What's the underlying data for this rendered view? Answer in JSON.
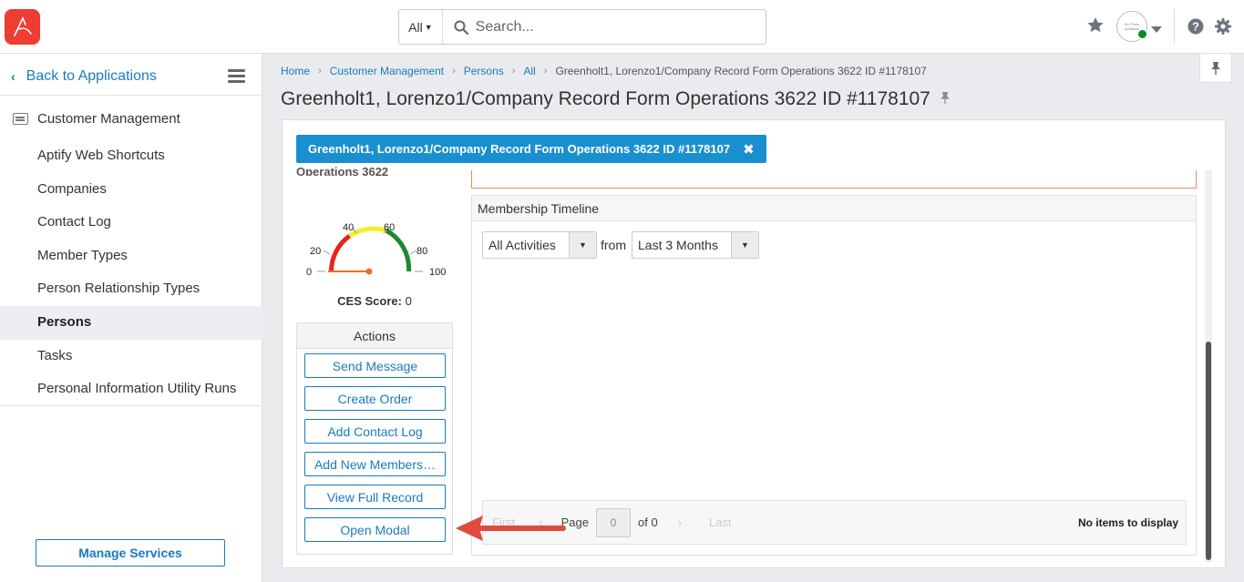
{
  "header": {
    "search_scope": "All",
    "search_placeholder": "Search...",
    "avatar_text": "No Photo Available"
  },
  "sidebar": {
    "back_label": "Back to Applications",
    "section_label": "Customer Management",
    "items": [
      {
        "label": "Aptify Web Shortcuts",
        "active": false
      },
      {
        "label": "Companies",
        "active": false
      },
      {
        "label": "Contact Log",
        "active": false
      },
      {
        "label": "Member Types",
        "active": false
      },
      {
        "label": "Person Relationship Types",
        "active": false
      },
      {
        "label": "Persons",
        "active": true
      },
      {
        "label": "Tasks",
        "active": false
      },
      {
        "label": "Personal Information Utility Runs",
        "active": false
      }
    ],
    "manage_services_label": "Manage Services"
  },
  "breadcrumb": [
    "Home",
    "Customer Management",
    "Persons",
    "All",
    "Greenholt1, Lorenzo1/Company Record Form Operations 3622 ID #1178107"
  ],
  "page_title": "Greenholt1, Lorenzo1/Company Record Form Operations 3622 ID #1178107",
  "record_tab": {
    "label": "Greenholt1, Lorenzo1/Company Record Form Operations 3622 ID #1178107"
  },
  "left": {
    "cut_text": "Operations 3622",
    "gauge": {
      "ticks": [
        "0",
        "20",
        "40",
        "60",
        "80",
        "100"
      ],
      "value": 0,
      "colors": {
        "red": "#e8231c",
        "yellow": "#f4ee2a",
        "green": "#1c8a2a",
        "needle": "#e8721c"
      }
    },
    "ces_label": "CES Score:",
    "ces_value": "0",
    "actions": {
      "title": "Actions",
      "buttons": [
        "Send Message",
        "Create Order",
        "Add Contact Log",
        "Add New Members…",
        "View Full Record",
        "Open Modal"
      ]
    }
  },
  "timeline": {
    "title": "Membership Timeline",
    "activity_filter": "All Activities",
    "from_label": "from",
    "range_filter": "Last 3 Months",
    "pager": {
      "first": "First",
      "prev": "‹",
      "page_label": "Page",
      "page_value": "0",
      "of_label": "of 0",
      "next": "›",
      "last": "Last",
      "empty_text": "No items to display"
    }
  },
  "colors": {
    "accent": "#1a8fd0",
    "link": "#1a7bbf",
    "logo": "#ee3d32",
    "arrow": "#e04a3f"
  }
}
